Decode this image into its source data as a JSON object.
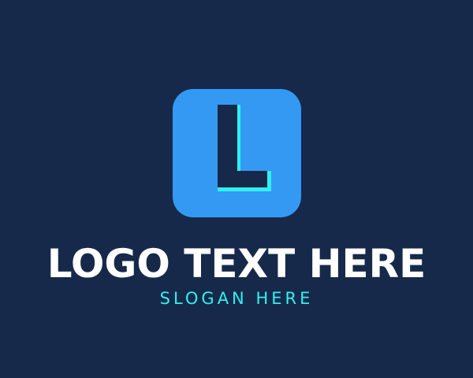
{
  "logo": {
    "icon_letter": "L",
    "icon_name": "letter-l-icon",
    "name": "LOGO TEXT HERE",
    "slogan": "SLOGAN HERE"
  },
  "colors": {
    "background": "#17294a",
    "icon_tile": "#3399f3",
    "letter_fill": "#17294a",
    "letter_outline": "#2ff0ef",
    "name_text": "#ffffff",
    "slogan_text": "#2ff0ef"
  }
}
